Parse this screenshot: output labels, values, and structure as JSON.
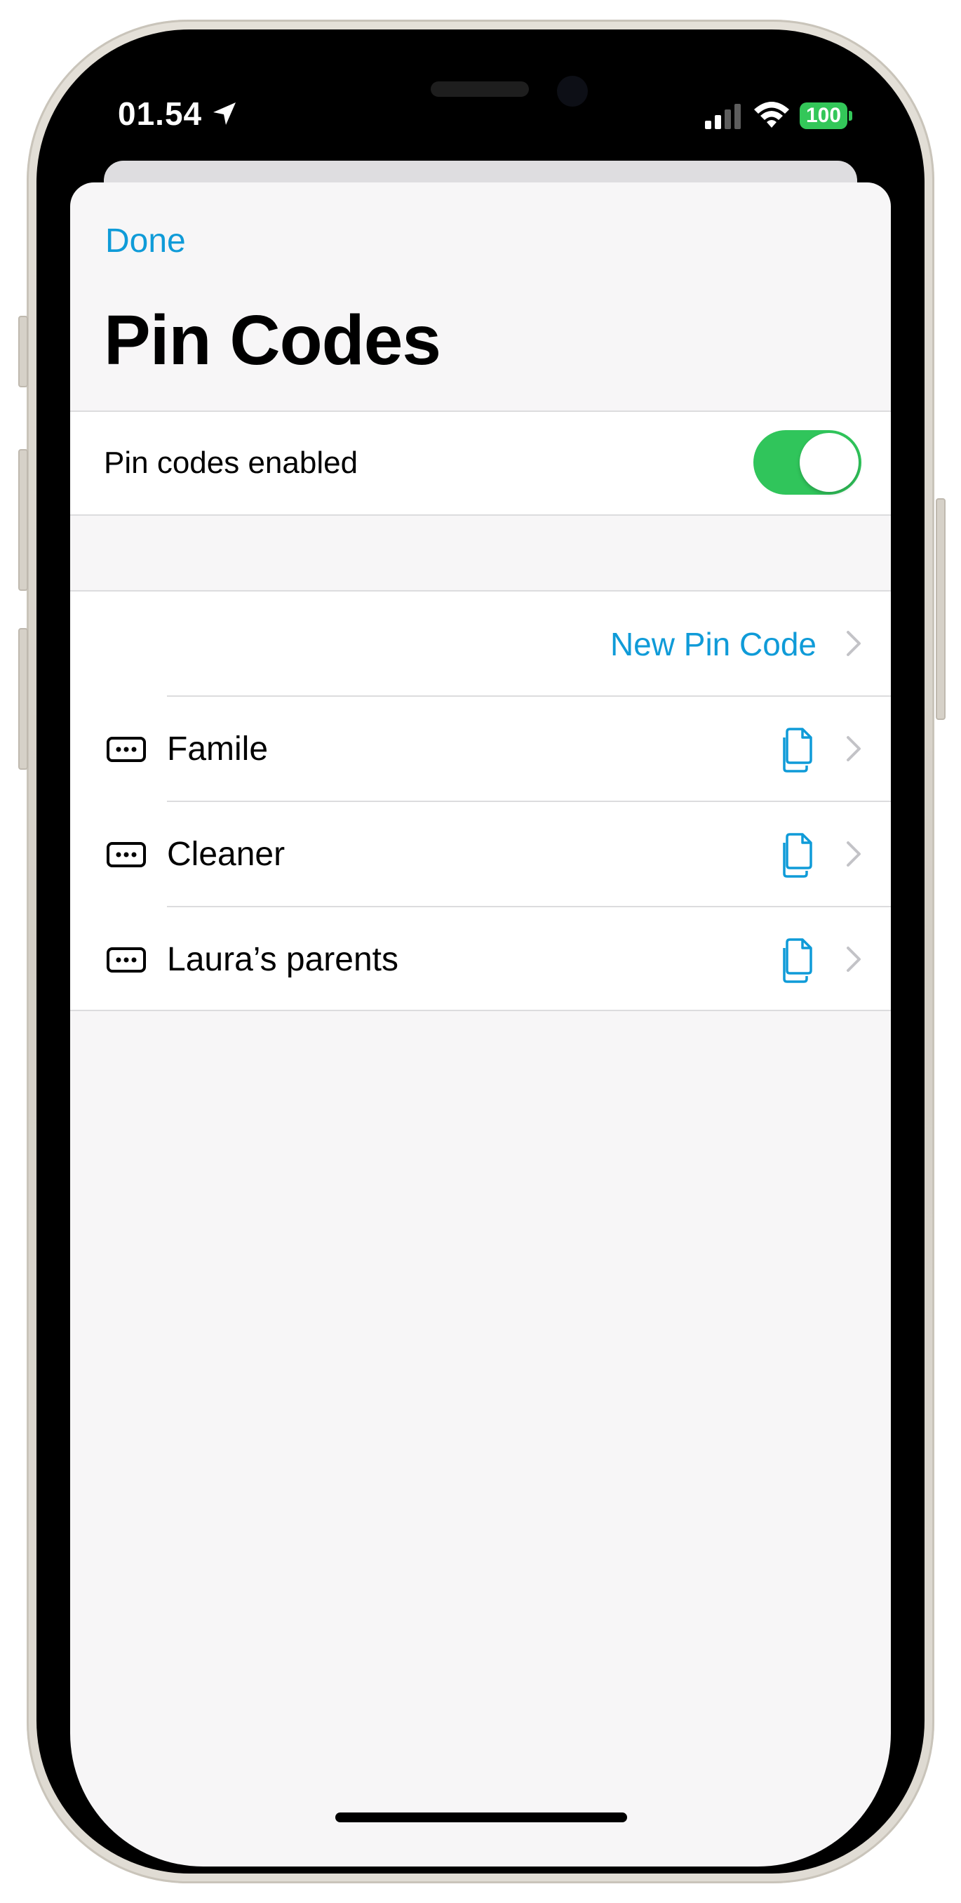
{
  "status_bar": {
    "time": "01.54",
    "battery": "100"
  },
  "nav": {
    "done_label": "Done"
  },
  "page": {
    "title": "Pin Codes"
  },
  "settings": {
    "pin_codes_enabled_label": "Pin codes enabled",
    "pin_codes_enabled": true
  },
  "pin_list": {
    "new_label": "New Pin Code",
    "items": [
      {
        "name": "Famile"
      },
      {
        "name": "Cleaner"
      },
      {
        "name": "Laura’s parents"
      }
    ]
  },
  "colors": {
    "accent": "#0f9bd8",
    "toggle_on": "#30c55b",
    "battery": "#33c759",
    "background": "#f7f6f7"
  },
  "icons": {
    "pin_item": "pin-field-icon",
    "copy": "copy-icon",
    "chevron": "chevron-right-icon",
    "location": "location-arrow-icon"
  }
}
